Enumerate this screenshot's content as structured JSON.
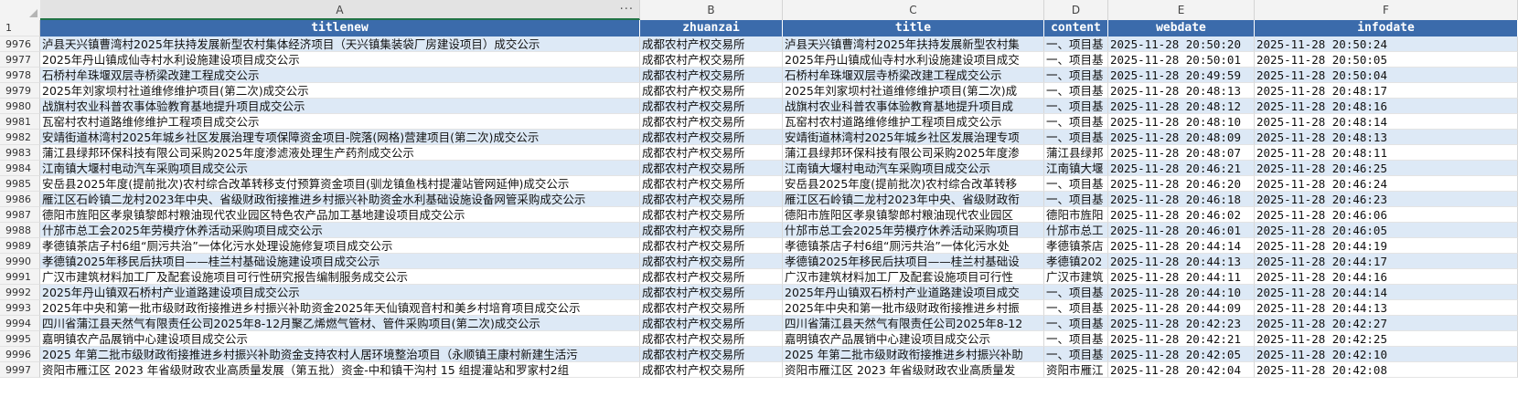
{
  "column_letters": [
    "A",
    "B",
    "C",
    "D",
    "E",
    "F"
  ],
  "header_row_number": "1",
  "headers": [
    "titlenew",
    "zhuanzai",
    "title",
    "content",
    "webdate",
    "infodate"
  ],
  "rows": [
    {
      "n": "9976",
      "a": "泸县天兴镇曹湾村2025年扶持发展新型农村集体经济项目（天兴镇集装袋厂房建设项目）成交公示",
      "b": "成都农村产权交易所",
      "c": "泸县天兴镇曹湾村2025年扶持发展新型农村集",
      "d": "一、项目基",
      "e": "2025-11-28 20:50:20",
      "f": "2025-11-28 20:50:24"
    },
    {
      "n": "9977",
      "a": "2025年丹山镇成仙寺村水利设施建设项目成交公示",
      "b": "成都农村产权交易所",
      "c": "2025年丹山镇成仙寺村水利设施建设项目成交",
      "d": "一、项目基",
      "e": "2025-11-28 20:50:01",
      "f": "2025-11-28 20:50:05"
    },
    {
      "n": "9978",
      "a": "石桥村牟珠堰双层寺桥梁改建工程成交公示",
      "b": "成都农村产权交易所",
      "c": "石桥村牟珠堰双层寺桥梁改建工程成交公示",
      "d": "一、项目基",
      "e": "2025-11-28 20:49:59",
      "f": "2025-11-28 20:50:04"
    },
    {
      "n": "9979",
      "a": "2025年刘家坝村社道维修维护项目(第二次)成交公示",
      "b": "成都农村产权交易所",
      "c": "2025年刘家坝村社道维修维护项目(第二次)成",
      "d": "一、项目基",
      "e": "2025-11-28 20:48:13",
      "f": "2025-11-28 20:48:17"
    },
    {
      "n": "9980",
      "a": "战旗村农业科普农事体验教育基地提升项目成交公示",
      "b": "成都农村产权交易所",
      "c": "战旗村农业科普农事体验教育基地提升项目成",
      "d": "一、项目基",
      "e": "2025-11-28 20:48:12",
      "f": "2025-11-28 20:48:16"
    },
    {
      "n": "9981",
      "a": "瓦窑村农村道路维修维护工程项目成交公示",
      "b": "成都农村产权交易所",
      "c": "瓦窑村农村道路维修维护工程项目成交公示",
      "d": "一、项目基",
      "e": "2025-11-28 20:48:10",
      "f": "2025-11-28 20:48:14"
    },
    {
      "n": "9982",
      "a": "安靖街道林湾村2025年城乡社区发展治理专项保障资金项目-院落(网格)营建项目(第二次)成交公示",
      "b": "成都农村产权交易所",
      "c": "安靖街道林湾村2025年城乡社区发展治理专项",
      "d": "一、项目基",
      "e": "2025-11-28 20:48:09",
      "f": "2025-11-28 20:48:13"
    },
    {
      "n": "9983",
      "a": "蒲江县绿邦环保科技有限公司采购2025年度渗滤液处理生产药剂成交公示",
      "b": "成都农村产权交易所",
      "c": "蒲江县绿邦环保科技有限公司采购2025年度渗",
      "d": "蒲江县绿邦",
      "e": "2025-11-28 20:48:07",
      "f": "2025-11-28 20:48:11"
    },
    {
      "n": "9984",
      "a": "江南镇大堰村电动汽车采购项目成交公示",
      "b": "成都农村产权交易所",
      "c": "江南镇大堰村电动汽车采购项目成交公示",
      "d": "江南镇大堰",
      "e": "2025-11-28 20:46:21",
      "f": "2025-11-28 20:46:25"
    },
    {
      "n": "9985",
      "a": "安岳县2025年度(提前批次)农村综合改革转移支付预算资金项目(驯龙镇鱼栈村提灌站管网延伸)成交公示",
      "b": "成都农村产权交易所",
      "c": "安岳县2025年度(提前批次)农村综合改革转移",
      "d": "一、项目基",
      "e": "2025-11-28 20:46:20",
      "f": "2025-11-28 20:46:24"
    },
    {
      "n": "9986",
      "a": "雁江区石岭镇二龙村2023年中央、省级财政衔接推进乡村振兴补助资金水利基础设施设备网管采购成交公示",
      "b": "成都农村产权交易所",
      "c": "雁江区石岭镇二龙村2023年中央、省级财政衔",
      "d": "一、项目基",
      "e": "2025-11-28 20:46:18",
      "f": "2025-11-28 20:46:23"
    },
    {
      "n": "9987",
      "a": "德阳市旌阳区孝泉镇黎郎村粮油现代农业园区特色农产品加工基地建设项目成交公示",
      "b": "成都农村产权交易所",
      "c": "德阳市旌阳区孝泉镇黎郎村粮油现代农业园区",
      "d": "德阳市旌阳",
      "e": "2025-11-28 20:46:02",
      "f": "2025-11-28 20:46:06"
    },
    {
      "n": "9988",
      "a": "什邡市总工会2025年劳模疗休养活动采购项目成交公示",
      "b": "成都农村产权交易所",
      "c": "什邡市总工会2025年劳模疗休养活动采购项目",
      "d": "什邡市总工",
      "e": "2025-11-28 20:46:01",
      "f": "2025-11-28 20:46:05"
    },
    {
      "n": "9989",
      "a": "孝德镇茶店子村6组“厕污共治”一体化污水处理设施修复项目成交公示",
      "b": "成都农村产权交易所",
      "c": "孝德镇茶店子村6组“厕污共治”一体化污水处",
      "d": "孝德镇茶店",
      "e": "2025-11-28 20:44:14",
      "f": "2025-11-28 20:44:19"
    },
    {
      "n": "9990",
      "a": "孝德镇2025年移民后扶项目——桂兰村基础设施建设项目成交公示",
      "b": "成都农村产权交易所",
      "c": "孝德镇2025年移民后扶项目——桂兰村基础设",
      "d": "孝德镇202",
      "e": "2025-11-28 20:44:13",
      "f": "2025-11-28 20:44:17"
    },
    {
      "n": "9991",
      "a": "广汉市建筑材料加工厂及配套设施项目可行性研究报告编制服务成交公示",
      "b": "成都农村产权交易所",
      "c": "广汉市建筑材料加工厂及配套设施项目可行性",
      "d": "广汉市建筑",
      "e": "2025-11-28 20:44:11",
      "f": "2025-11-28 20:44:16"
    },
    {
      "n": "9992",
      "a": "2025年丹山镇双石桥村产业道路建设项目成交公示",
      "b": "成都农村产权交易所",
      "c": "2025年丹山镇双石桥村产业道路建设项目成交",
      "d": "一、项目基",
      "e": "2025-11-28 20:44:10",
      "f": "2025-11-28 20:44:14"
    },
    {
      "n": "9993",
      "a": "2025年中央和第一批市级财政衔接推进乡村振兴补助资金2025年天仙镇观音村和美乡村培育项目成交公示",
      "b": "成都农村产权交易所",
      "c": "2025年中央和第一批市级财政衔接推进乡村振",
      "d": "一、项目基",
      "e": "2025-11-28 20:44:09",
      "f": "2025-11-28 20:44:13"
    },
    {
      "n": "9994",
      "a": "四川省蒲江县天然气有限责任公司2025年8-12月聚乙烯燃气管材、管件采购项目(第二次)成交公示",
      "b": "成都农村产权交易所",
      "c": "四川省蒲江县天然气有限责任公司2025年8-12",
      "d": "一、项目基",
      "e": "2025-11-28 20:42:23",
      "f": "2025-11-28 20:42:27"
    },
    {
      "n": "9995",
      "a": "嘉明镇农产品展销中心建设项目成交公示",
      "b": "成都农村产权交易所",
      "c": "嘉明镇农产品展销中心建设项目成交公示",
      "d": "一、项目基",
      "e": "2025-11-28 20:42:21",
      "f": "2025-11-28 20:42:25"
    },
    {
      "n": "9996",
      "a": "2025 年第二批市级财政衔接推进乡村振兴补助资金支持农村人居环境整治项目（永顺镇王康村新建生活污",
      "b": "成都农村产权交易所",
      "c": "2025 年第二批市级财政衔接推进乡村振兴补助",
      "d": "一、项目基",
      "e": "2025-11-28 20:42:05",
      "f": "2025-11-28 20:42:10"
    },
    {
      "n": "9997",
      "a": "资阳市雁江区 2023 年省级财政农业高质量发展（第五批）资金-中和镇干沟村 15 组提灌站和罗家村2组",
      "b": "成都农村产权交易所",
      "c": "资阳市雁江区 2023 年省级财政农业高质量发",
      "d": "资阳市雁江",
      "e": "2025-11-28 20:42:04",
      "f": "2025-11-28 20:42:08"
    }
  ]
}
